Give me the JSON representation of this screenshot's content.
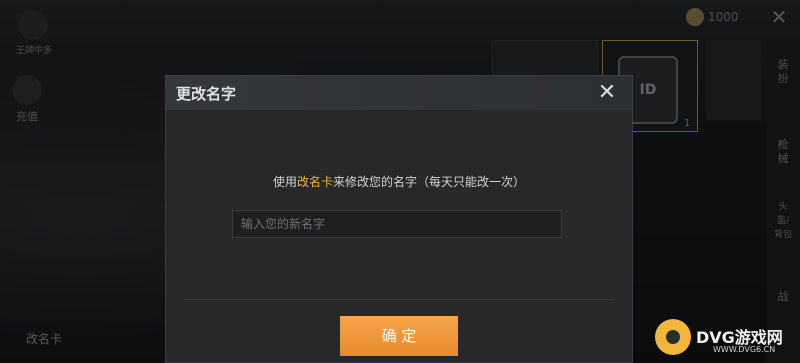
{
  "background": {
    "left_top_label": "王牌中多",
    "left_label": "充值",
    "left_bottom_label": "改名卡",
    "coin_amount": "1000",
    "tabs": [
      "装扮",
      "枪械",
      "头盔/背包",
      "战"
    ],
    "item_icon_text": "ID",
    "item_count": "1"
  },
  "modal": {
    "title": "更改名字",
    "message_prefix": "使用",
    "message_highlight": "改名卡",
    "message_suffix": "来修改您的名字（每天只能改一次）",
    "input_placeholder": "输入您的新名字",
    "input_value": "",
    "confirm_label": "确 定"
  },
  "watermark": {
    "text": "DVG游戏网",
    "url": "WWW.DVG6.CN"
  },
  "colors": {
    "accent": "#f2b13a",
    "button": "#f39b3e"
  }
}
